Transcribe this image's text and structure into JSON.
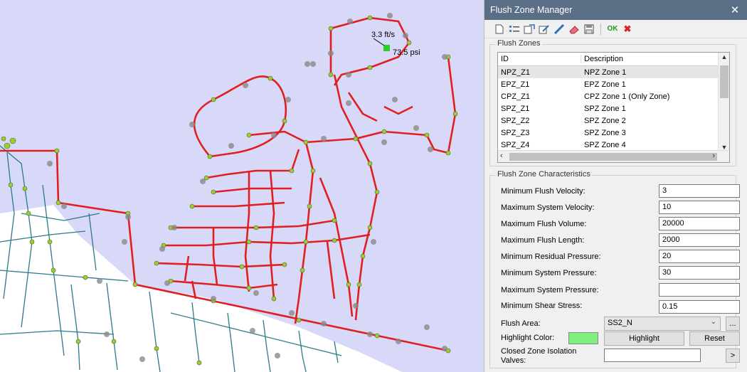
{
  "map": {
    "velocity_label": "3.3 ft/s",
    "pressure_label": "73.5 psi",
    "colors": {
      "background": "#d8d8f8",
      "zone_pipe": "#e02020",
      "other_pipe": "#2a7a8a",
      "node": "#9acd32",
      "valve": "#8a8a8a"
    }
  },
  "panel": {
    "title": "Flush Zone Manager",
    "close_symbol": "✕",
    "toolbar": {
      "buttons": [
        "new-icon",
        "properties-icon",
        "export-icon",
        "edit-icon",
        "draw-icon",
        "erase-icon",
        "save-icon"
      ],
      "ok_label": "OK",
      "cancel_symbol": "✖"
    },
    "zones": {
      "group_title": "Flush Zones",
      "columns": [
        "ID",
        "Description"
      ],
      "rows": [
        {
          "id": "NPZ_Z1",
          "description": "NPZ Zone 1"
        },
        {
          "id": "EPZ_Z1",
          "description": "EPZ Zone 1"
        },
        {
          "id": "CPZ_Z1",
          "description": "CPZ Zone 1 (Only Zone)"
        },
        {
          "id": "SPZ_Z1",
          "description": "SPZ Zone 1"
        },
        {
          "id": "SPZ_Z2",
          "description": "SPZ Zone 2"
        },
        {
          "id": "SPZ_Z3",
          "description": "SPZ Zone 3"
        },
        {
          "id": "SPZ_Z4",
          "description": "SPZ Zone 4"
        }
      ]
    },
    "characteristics": {
      "group_title": "Flush Zone Characteristics",
      "min_flush_velocity": {
        "label": "Minimum Flush Velocity:",
        "value": "3"
      },
      "max_system_velocity": {
        "label": "Maximum System Velocity:",
        "value": "10"
      },
      "max_flush_volume": {
        "label": "Maximum Flush Volume:",
        "value": "20000"
      },
      "max_flush_length": {
        "label": "Maximum Flush Length:",
        "value": "2000"
      },
      "min_residual_pressure": {
        "label": "Minimum Residual Pressure:",
        "value": "20"
      },
      "min_system_pressure": {
        "label": "Minimum System Pressure:",
        "value": "30"
      },
      "max_system_pressure": {
        "label": "Maximum System Pressure:",
        "value": ""
      },
      "min_shear_stress": {
        "label": "Minimum Shear Stress:",
        "value": "0.15"
      },
      "flush_area_label": "Flush Area:",
      "flush_area_value": "SS2_N",
      "browse_label": "...",
      "highlight_color_label": "Highlight Color:",
      "highlight_color": "#80f080",
      "highlight_button": "Highlight",
      "reset_button": "Reset",
      "closed_valves_label": "Closed Zone Isolation Valves:",
      "closed_valves_value": "",
      "go_button": ">"
    }
  }
}
